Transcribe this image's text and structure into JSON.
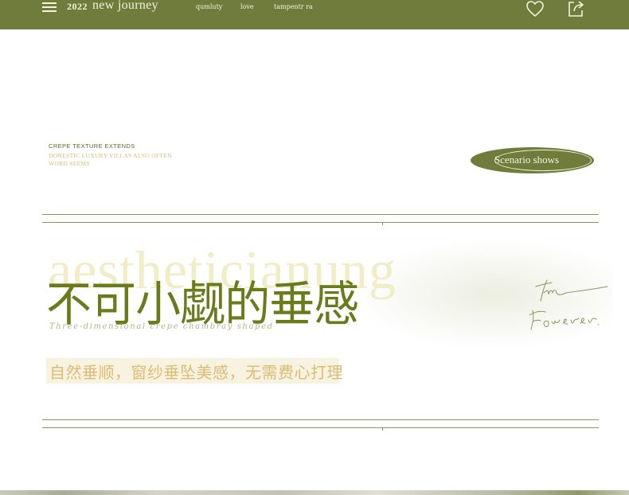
{
  "header": {
    "year": "2022",
    "brand": "new journey",
    "nav": [
      "qumluty",
      "love",
      "tampentr ra"
    ],
    "icons": [
      "menu-icon",
      "heart-icon",
      "share-icon"
    ]
  },
  "texture": {
    "title": "CREPE TEXTURE EXTENDS",
    "subtitle_line1": "DONESTIC LUXURY VILLAS ALSO OFTEN",
    "subtitle_line2": "WORD SEEMS"
  },
  "scenario_button": {
    "label": "Scenario shows"
  },
  "hero": {
    "background_word": "aestheticianung",
    "title": "不可小觑的垂感",
    "script_line": "Three-dimensional crepe chambray shaped",
    "subtitle": "自然垂顺，窗纱垂坠美感，无需费心打理"
  },
  "signature": {
    "line1": "time",
    "line2": "Forever."
  },
  "colors": {
    "header_bg": "#6f7c3b",
    "title_green": "#6a7b1c",
    "gold": "#dcbc72",
    "rule": "#8b9559"
  }
}
